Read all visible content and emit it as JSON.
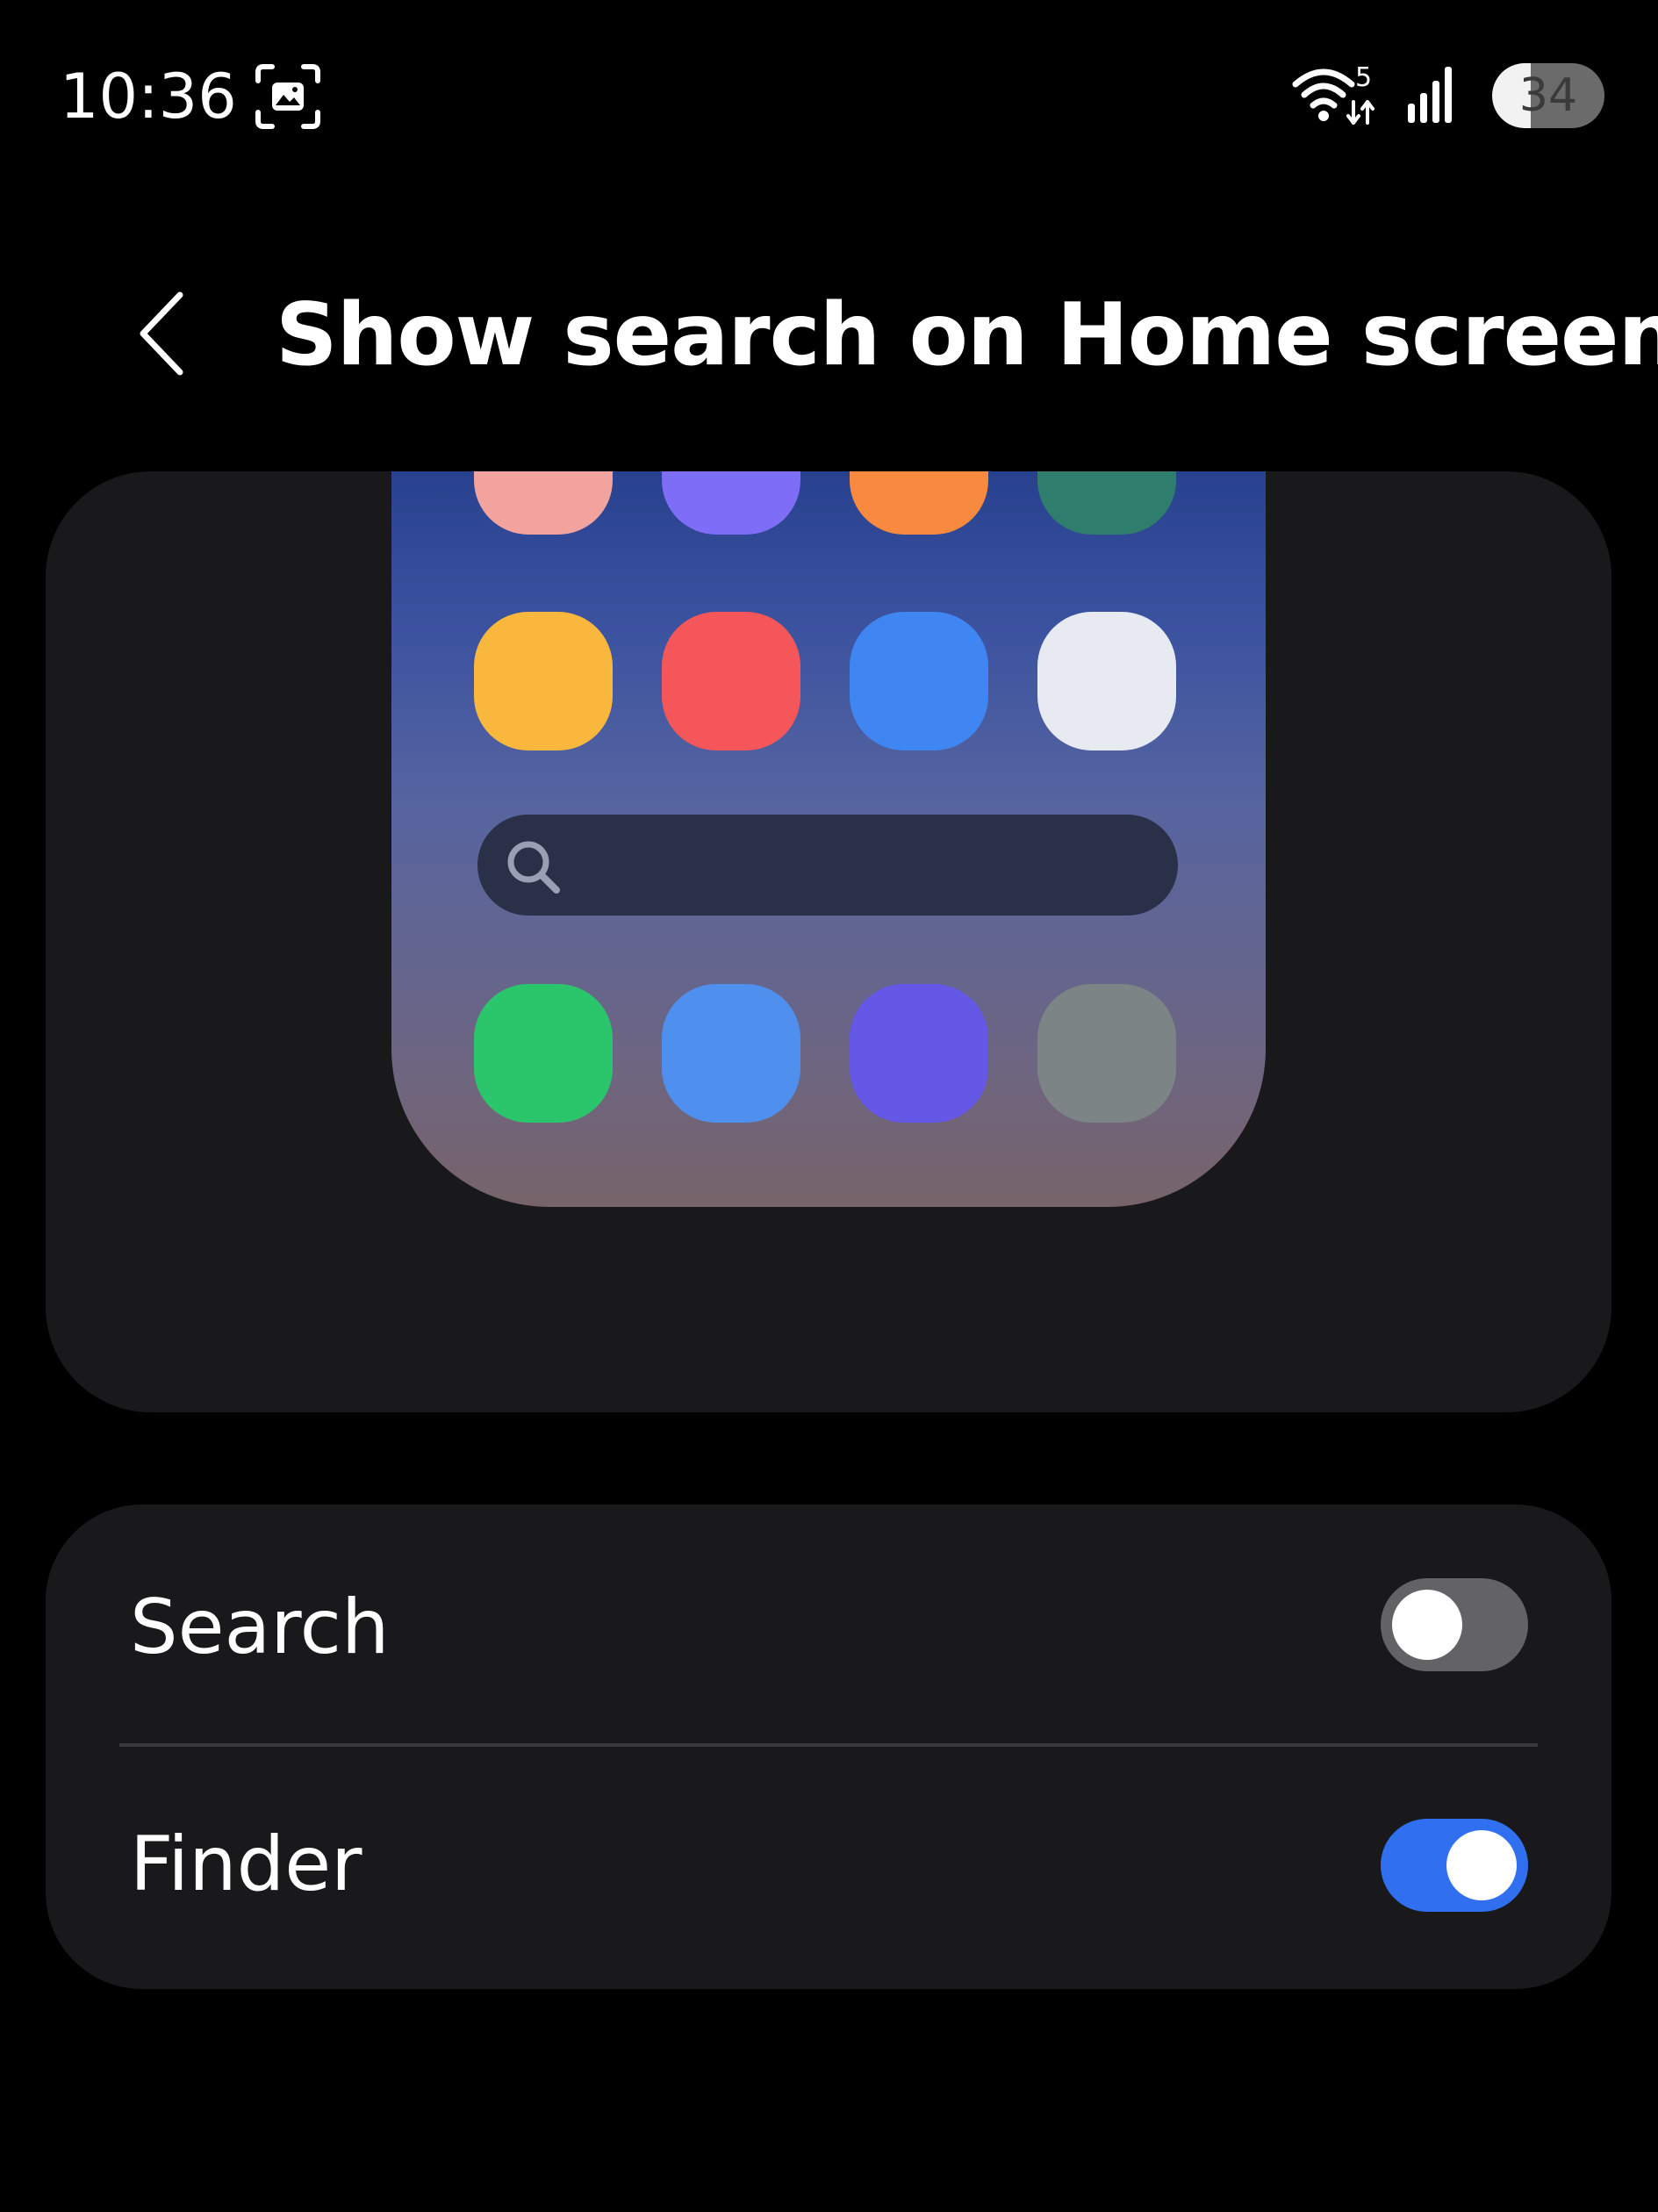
{
  "status_bar": {
    "time": "10:36",
    "wifi_badge": "5",
    "battery_level": "34",
    "battery_percent": 34,
    "icons": [
      "screenshot-icon",
      "wifi-icon",
      "signal-icon",
      "battery-icon"
    ]
  },
  "header": {
    "back_icon": "chevron-left-icon",
    "title": "Show search on Home screen"
  },
  "preview": {
    "description_icons": [
      "app-icon",
      "search-icon"
    ],
    "app_icon_colors": {
      "row1": [
        "#f2a39d",
        "#7d6df7",
        "#f78a3f",
        "#2e7d6d"
      ],
      "row2": [
        "#f9b83d",
        "#f4565a",
        "#3f86f2",
        "#e8eaf1"
      ],
      "row3": [
        "#2bc56c",
        "#4f90ee",
        "#6558e6",
        "#7c8486"
      ]
    },
    "background_colors": [
      "#28418e",
      "#776469"
    ],
    "search_bar_color": "#2b3049"
  },
  "settings": {
    "items": [
      {
        "label": "Search",
        "enabled": false
      },
      {
        "label": "Finder",
        "enabled": true
      }
    ]
  },
  "colors": {
    "background": "#000000",
    "card": "#19191b",
    "toggle_on": "#2f6ff0",
    "toggle_off": "#636366"
  }
}
